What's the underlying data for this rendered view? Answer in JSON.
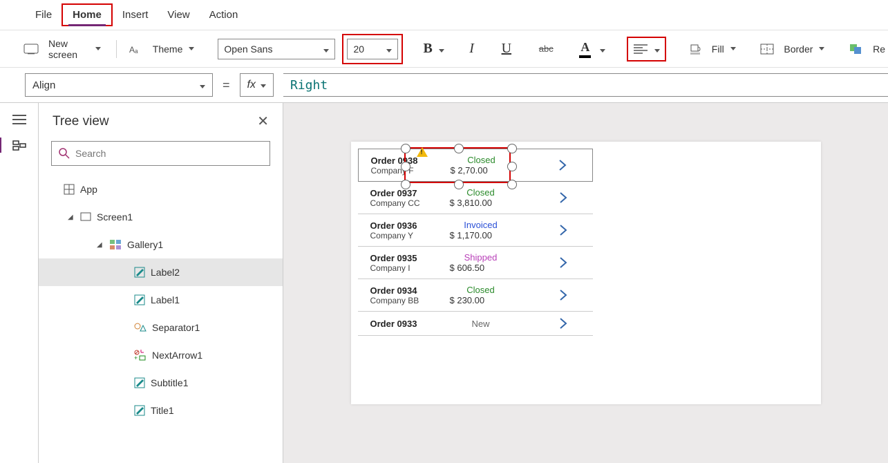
{
  "menu": {
    "file": "File",
    "home": "Home",
    "insert": "Insert",
    "view": "View",
    "action": "Action"
  },
  "ribbon": {
    "new_screen": "New screen",
    "theme": "Theme",
    "font_name": "Open Sans",
    "font_size": "20",
    "fill": "Fill",
    "border": "Border",
    "reorder_partial": "Re"
  },
  "propbar": {
    "property": "Align",
    "formula": "Right"
  },
  "tree": {
    "title": "Tree view",
    "search_placeholder": "Search",
    "app": "App",
    "screen1": "Screen1",
    "gallery1": "Gallery1",
    "label2": "Label2",
    "label1": "Label1",
    "separator1": "Separator1",
    "nextarrow1": "NextArrow1",
    "subtitle1": "Subtitle1",
    "title1": "Title1"
  },
  "orders": [
    {
      "id": "Order 0938",
      "company": "Company F",
      "status": "Closed",
      "status_class": "st-closed",
      "price": "$ 2,70.00"
    },
    {
      "id": "Order 0937",
      "company": "Company CC",
      "status": "Closed",
      "status_class": "st-closed",
      "price": "$ 3,810.00"
    },
    {
      "id": "Order 0936",
      "company": "Company Y",
      "status": "Invoiced",
      "status_class": "st-invoiced",
      "price": "$ 1,170.00"
    },
    {
      "id": "Order 0935",
      "company": "Company I",
      "status": "Shipped",
      "status_class": "st-shipped",
      "price": "$ 606.50"
    },
    {
      "id": "Order 0934",
      "company": "Company BB",
      "status": "Closed",
      "status_class": "st-closed",
      "price": "$ 230.00"
    },
    {
      "id": "Order 0933",
      "company": "",
      "status": "New",
      "status_class": "st-new",
      "price": ""
    }
  ]
}
